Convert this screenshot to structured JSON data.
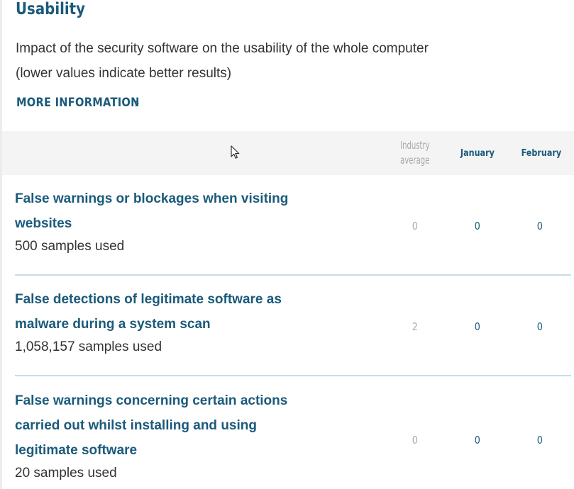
{
  "section": {
    "title": "Usability",
    "description_line1": "Impact of the security software on the usability of the whole computer",
    "description_line2": "(lower values indicate better results)",
    "more_info_label": "MORE INFORMATION",
    "more_info_icon": "chevron-right-icon"
  },
  "table": {
    "headers": {
      "industry_line1": "Industry",
      "industry_line2": "average",
      "january": "January",
      "february": "February"
    },
    "rows": [
      {
        "title_line1": "False warnings or blockages when visiting",
        "title_line2": "websites",
        "title_line3": "",
        "samples": "500 samples used",
        "industry": "0",
        "january": "0",
        "february": "0"
      },
      {
        "title_line1": "False detections of legitimate software as",
        "title_line2": "malware during a system scan",
        "title_line3": "",
        "samples": "1,058,157 samples used",
        "industry": "2",
        "january": "0",
        "february": "0"
      },
      {
        "title_line1": "False warnings concerning certain actions",
        "title_line2": "carried out whilst installing and using",
        "title_line3": "legitimate software",
        "samples": "20 samples used",
        "industry": "0",
        "january": "0",
        "february": "0"
      }
    ]
  },
  "colors": {
    "accent": "#1b5a7a",
    "muted": "#a9a9a9",
    "text": "#333333",
    "header_bg": "#f4f4f4",
    "divider": "#c9dce3"
  }
}
